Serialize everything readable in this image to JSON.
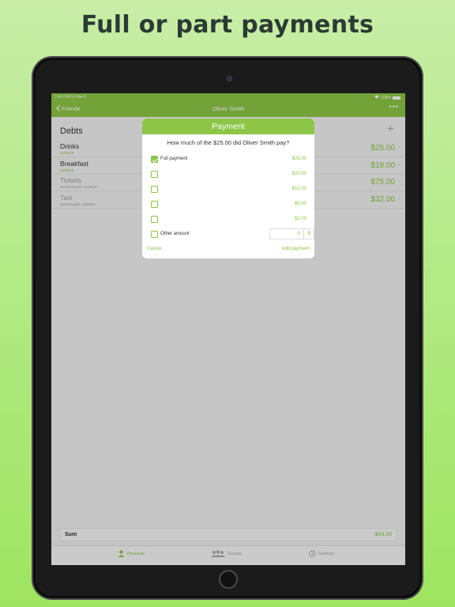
{
  "headline": "Full or part payments",
  "statusbar": {
    "time": "2:46 PM   Fri Mar 6",
    "battery": "100%"
  },
  "navbar": {
    "back_label": "Friends",
    "title": "Oliver Smith",
    "more": "•••"
  },
  "debts": {
    "title": "Debts",
    "items": [
      {
        "name": "Drinks",
        "date": "11/25/19",
        "amount": "$25.00",
        "paid": false
      },
      {
        "name": "Breakfast",
        "date": "11/20/19",
        "amount": "$18.00",
        "paid": false
      },
      {
        "name": "Tickets",
        "date": "11/12/19 paid: 11/25/19",
        "amount": "$75.00",
        "paid": true
      },
      {
        "name": "Taxi",
        "date": "11/1/19 paid: 11/25/19",
        "amount": "$32.00",
        "paid": true
      }
    ]
  },
  "sum": {
    "label": "Sum",
    "value": "$43.00"
  },
  "tabs": [
    {
      "label": "Personal",
      "icon": "person-icon",
      "active": true
    },
    {
      "label": "Groups",
      "icon": "group-icon",
      "active": false
    },
    {
      "label": "Settings",
      "icon": "settings-icon",
      "active": false
    }
  ],
  "dialog": {
    "title": "Payment",
    "question": "How much of the $25.00 did Oliver Smith pay?",
    "options": [
      {
        "label": "Full payment",
        "amount": "$25.00",
        "checked": true
      },
      {
        "label": "",
        "amount": "$20.00",
        "checked": false
      },
      {
        "label": "",
        "amount": "$10.00",
        "checked": false
      },
      {
        "label": "",
        "amount": "$5.00",
        "checked": false
      },
      {
        "label": "",
        "amount": "$2.00",
        "checked": false
      }
    ],
    "other": {
      "label": "Other amount",
      "value": "0",
      "currency": "$"
    },
    "cancel_label": "Cancel",
    "add_label": "Add payment"
  },
  "colors": {
    "accent": "#8dc646",
    "background": "#b3ea86"
  }
}
